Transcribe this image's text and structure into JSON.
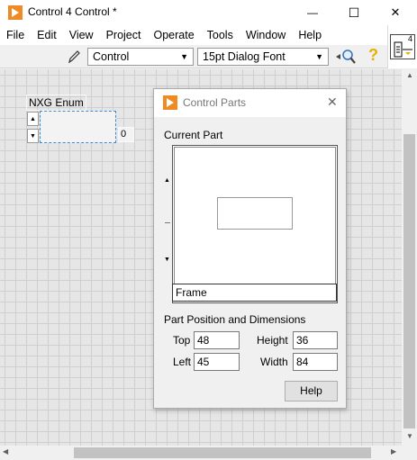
{
  "window": {
    "title": "Control 4 Control *",
    "minimize_glyph": "—",
    "maximize_glyph": "☐",
    "close_glyph": "✕"
  },
  "menu": [
    "File",
    "Edit",
    "View",
    "Project",
    "Operate",
    "Tools",
    "Window",
    "Help"
  ],
  "toolbar": {
    "control_type": "Control",
    "font": "15pt Dialog Font"
  },
  "connector_pane": {
    "number": "4"
  },
  "canvas": {
    "enum": {
      "label": "NXG Enum",
      "value": "0"
    }
  },
  "dialog": {
    "title": "Control Parts",
    "current_part_label": "Current Part",
    "part_name": "Frame",
    "section_label": "Part Position and Dimensions",
    "top_label": "Top",
    "top_value": "48",
    "left_label": "Left",
    "left_value": "45",
    "height_label": "Height",
    "height_value": "36",
    "width_label": "Width",
    "width_value": "84",
    "help_button": "Help"
  },
  "colors": {
    "brand_orange": "#f5a623",
    "grid": "#cfcfcf",
    "canvas_bg": "#e6e6e6",
    "selection": "#3a8bd6"
  }
}
